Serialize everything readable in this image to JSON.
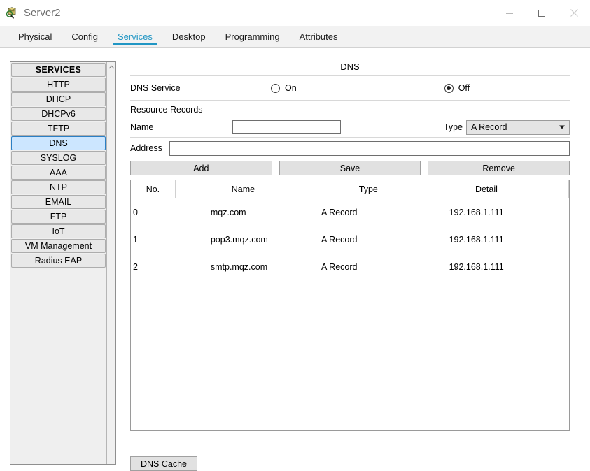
{
  "window": {
    "title": "Server2",
    "icon": "server-device-icon",
    "controls": {
      "minimize": "minimize-icon",
      "maximize": "maximize-icon",
      "close": "close-icon"
    }
  },
  "tabs": [
    {
      "label": "Physical",
      "active": false
    },
    {
      "label": "Config",
      "active": false
    },
    {
      "label": "Services",
      "active": true
    },
    {
      "label": "Desktop",
      "active": false
    },
    {
      "label": "Programming",
      "active": false
    },
    {
      "label": "Attributes",
      "active": false
    }
  ],
  "sidebar": {
    "header": "SERVICES",
    "items": [
      {
        "label": "HTTP",
        "selected": false
      },
      {
        "label": "DHCP",
        "selected": false
      },
      {
        "label": "DHCPv6",
        "selected": false
      },
      {
        "label": "TFTP",
        "selected": false
      },
      {
        "label": "DNS",
        "selected": true
      },
      {
        "label": "SYSLOG",
        "selected": false
      },
      {
        "label": "AAA",
        "selected": false
      },
      {
        "label": "NTP",
        "selected": false
      },
      {
        "label": "EMAIL",
        "selected": false
      },
      {
        "label": "FTP",
        "selected": false
      },
      {
        "label": "IoT",
        "selected": false
      },
      {
        "label": "VM Management",
        "selected": false
      },
      {
        "label": "Radius EAP",
        "selected": false
      }
    ]
  },
  "main": {
    "panel_title": "DNS",
    "service": {
      "label": "DNS Service",
      "on_label": "On",
      "off_label": "Off",
      "selected": "Off"
    },
    "resource_records": {
      "section_label": "Resource Records",
      "name_label": "Name",
      "name_value": "",
      "name_placeholder": "",
      "type_label": "Type",
      "type_value": "A Record",
      "address_label": "Address",
      "address_value": "",
      "address_placeholder": ""
    },
    "buttons": {
      "add": "Add",
      "save": "Save",
      "remove": "Remove"
    },
    "table": {
      "columns": [
        "No.",
        "Name",
        "Type",
        "Detail"
      ],
      "rows": [
        {
          "no": "0",
          "name": "mqz.com",
          "type": "A Record",
          "detail": "192.168.1.111"
        },
        {
          "no": "1",
          "name": "pop3.mqz.com",
          "type": "A Record",
          "detail": "192.168.1.111"
        },
        {
          "no": "2",
          "name": "smtp.mqz.com",
          "type": "A Record",
          "detail": "192.168.1.111"
        }
      ]
    },
    "dns_cache_button": "DNS Cache"
  },
  "colors": {
    "accent": "#2196c4",
    "selection": "#cce6ff",
    "button_face": "#e1e1e1",
    "tabbar": "#f2f2f2"
  }
}
